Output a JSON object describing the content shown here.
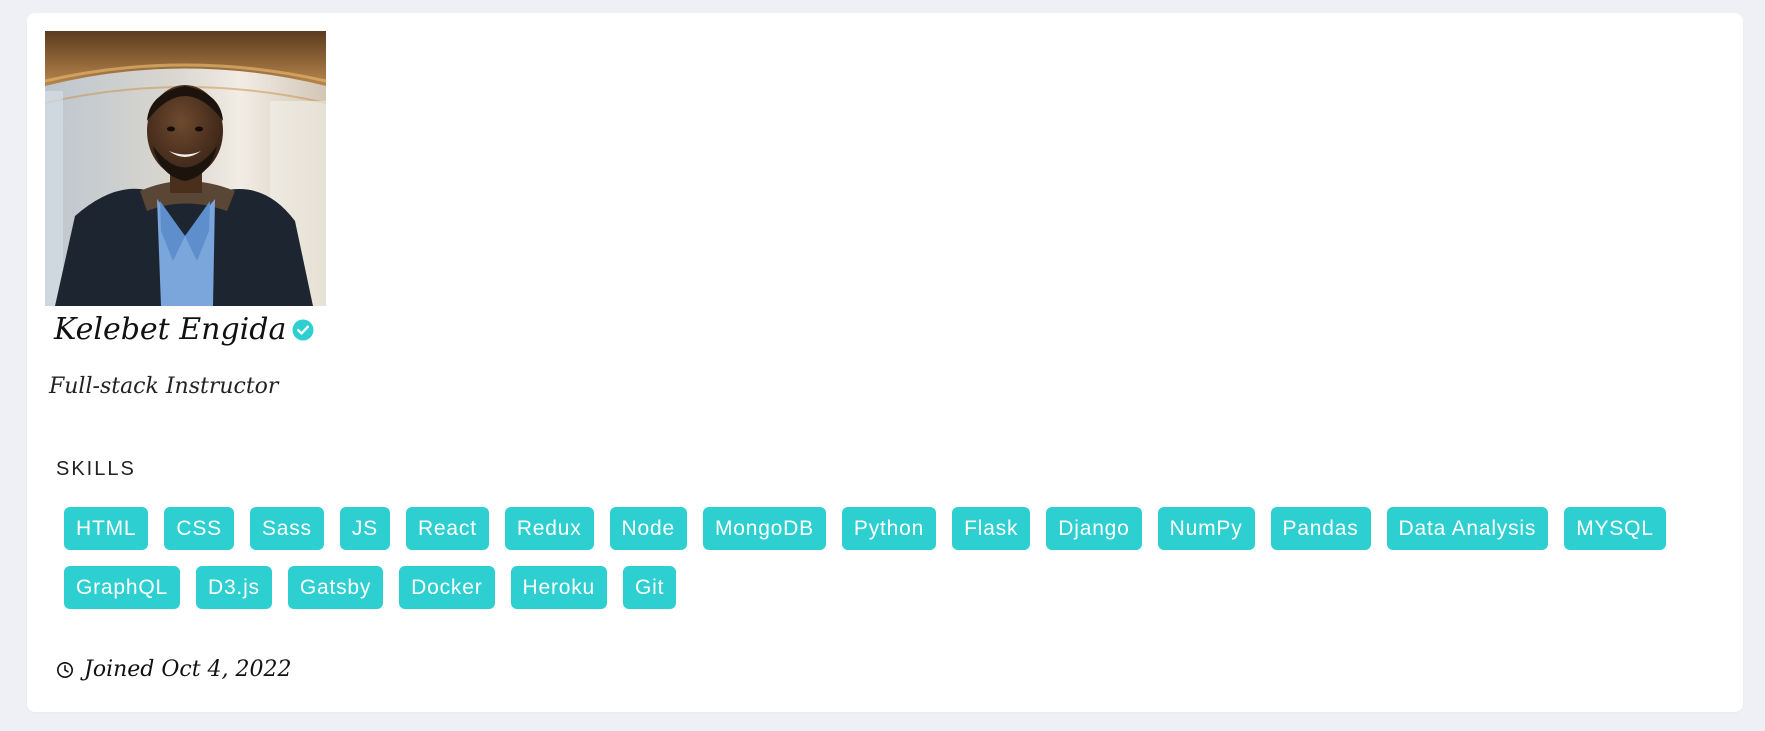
{
  "profile": {
    "name": "Kelebet Engida",
    "role": "Full-stack Instructor",
    "avatar_alt": "Kelebet Engida"
  },
  "skills_title": "SKILLS",
  "skills": [
    "HTML",
    "CSS",
    "Sass",
    "JS",
    "React",
    "Redux",
    "Node",
    "MongoDB",
    "Python",
    "Flask",
    "Django",
    "NumPy",
    "Pandas",
    "Data Analysis",
    "MYSQL",
    "GraphQL",
    "D3.js",
    "Gatsby",
    "Docker",
    "Heroku",
    "Git"
  ],
  "joined": {
    "icon": "clock-icon",
    "text": "Joined Oct 4, 2022"
  },
  "colors": {
    "accent": "#2ecfd1",
    "background": "#eef0f5",
    "card": "#ffffff"
  }
}
